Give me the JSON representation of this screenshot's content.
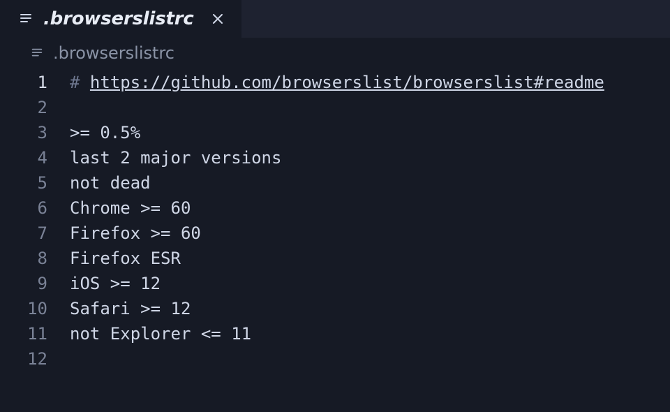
{
  "tab": {
    "filename": ".browserslistrc",
    "icon": "text-lines-icon"
  },
  "breadcrumb": {
    "filename": ".browserslistrc",
    "icon": "text-lines-icon"
  },
  "editor": {
    "current_line": 1,
    "lines": [
      {
        "n": 1,
        "segments": [
          {
            "cls": "tok-comment",
            "text": "# "
          },
          {
            "cls": "tok-link",
            "text": "https://github.com/browserslist/browserslist#readme",
            "interact": true
          }
        ]
      },
      {
        "n": 2,
        "segments": [
          {
            "cls": "",
            "text": ""
          }
        ]
      },
      {
        "n": 3,
        "segments": [
          {
            "cls": "",
            "text": ">= 0.5%"
          }
        ]
      },
      {
        "n": 4,
        "segments": [
          {
            "cls": "",
            "text": "last 2 major versions"
          }
        ]
      },
      {
        "n": 5,
        "segments": [
          {
            "cls": "",
            "text": "not dead"
          }
        ]
      },
      {
        "n": 6,
        "segments": [
          {
            "cls": "",
            "text": "Chrome >= 60"
          }
        ]
      },
      {
        "n": 7,
        "segments": [
          {
            "cls": "",
            "text": "Firefox >= 60"
          }
        ]
      },
      {
        "n": 8,
        "segments": [
          {
            "cls": "",
            "text": "Firefox ESR"
          }
        ]
      },
      {
        "n": 9,
        "segments": [
          {
            "cls": "",
            "text": "iOS >= 12"
          }
        ]
      },
      {
        "n": 10,
        "segments": [
          {
            "cls": "",
            "text": "Safari >= 12"
          }
        ]
      },
      {
        "n": 11,
        "segments": [
          {
            "cls": "",
            "text": "not Explorer <= 11"
          }
        ]
      },
      {
        "n": 12,
        "segments": [
          {
            "cls": "",
            "text": ""
          }
        ]
      }
    ]
  }
}
